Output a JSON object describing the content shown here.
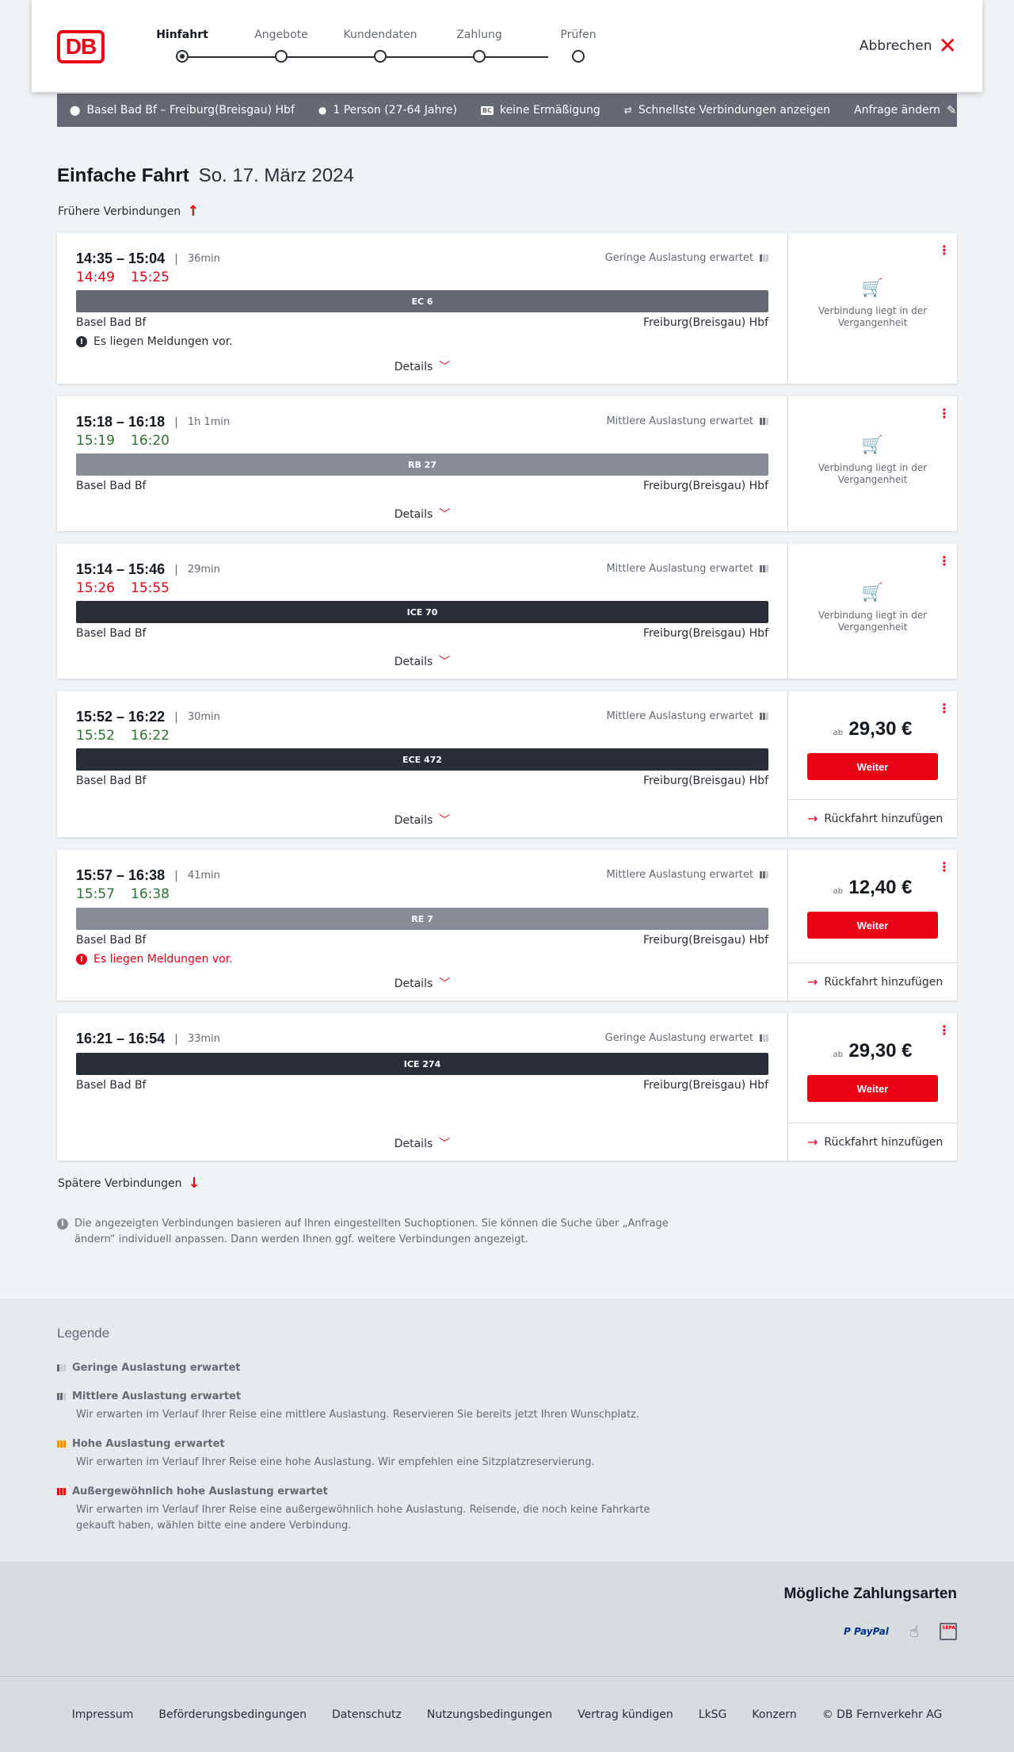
{
  "header": {
    "logo": "DB",
    "steps": [
      {
        "label": "Hinfahrt",
        "active": true
      },
      {
        "label": "Angebote",
        "active": false
      },
      {
        "label": "Kundendaten",
        "active": false
      },
      {
        "label": "Zahlung",
        "active": false
      },
      {
        "label": "Prüfen",
        "active": false
      }
    ],
    "cancel_label": "Abbrechen"
  },
  "search": {
    "route": "Basel Bad Bf – Freiburg(Breisgau) Hbf",
    "passengers": "1 Person (27-64 Jahre)",
    "discount_badge": "BC",
    "discount": "keine Ermäßigung",
    "fastest": "Schnellste Verbindungen anzeigen",
    "change": "Anfrage ändern"
  },
  "trip": {
    "type": "Einfache Fahrt",
    "date": "So. 17. März 2024",
    "earlier": "Frühere Verbindungen",
    "later": "Spätere Verbindungen"
  },
  "connections": [
    {
      "times": "14:35 – 15:04",
      "duration": "36min",
      "rt_dep": "14:49",
      "rt_arr": "15:25",
      "rt_status": "delayed",
      "load": "Geringe Auslastung erwartet",
      "load_level": 1,
      "train": "EC 6",
      "bar": "grey",
      "from": "Basel Bad Bf",
      "to": "Freiburg(Breisgau) Hbf",
      "message": "Es liegen Meldungen vor.",
      "message_type": "info",
      "details": "Details",
      "past_text": "Verbindung liegt in der Vergangenheit",
      "price_prefix": null,
      "price": null,
      "cta": null,
      "return_label": null
    },
    {
      "times": "15:18 – 16:18",
      "duration": "1h 1min",
      "rt_dep": "15:19",
      "rt_arr": "16:20",
      "rt_status": "ontime",
      "load": "Mittlere Auslastung erwartet",
      "load_level": 2,
      "train": "RB 27",
      "bar": "light",
      "from": "Basel Bad Bf",
      "to": "Freiburg(Breisgau) Hbf",
      "message": null,
      "message_type": null,
      "details": "Details",
      "past_text": "Verbindung liegt in der Vergangenheit",
      "price_prefix": null,
      "price": null,
      "cta": null,
      "return_label": null
    },
    {
      "times": "15:14 – 15:46",
      "duration": "29min",
      "rt_dep": "15:26",
      "rt_arr": "15:55",
      "rt_status": "delayed",
      "load": "Mittlere Auslastung erwartet",
      "load_level": 2,
      "train": "ICE 70",
      "bar": "dark",
      "from": "Basel Bad Bf",
      "to": "Freiburg(Breisgau) Hbf",
      "message": null,
      "message_type": null,
      "details": "Details",
      "past_text": "Verbindung liegt in der Vergangenheit",
      "price_prefix": null,
      "price": null,
      "cta": null,
      "return_label": null
    },
    {
      "times": "15:52 – 16:22",
      "duration": "30min",
      "rt_dep": "15:52",
      "rt_arr": "16:22",
      "rt_status": "ontime",
      "load": "Mittlere Auslastung erwartet",
      "load_level": 2,
      "train": "ECE 472",
      "bar": "dark",
      "from": "Basel Bad Bf",
      "to": "Freiburg(Breisgau) Hbf",
      "message": null,
      "message_type": null,
      "details": "Details",
      "past_text": null,
      "price_prefix": "ab",
      "price": "29,30 €",
      "cta": "Weiter",
      "return_label": "Rückfahrt hinzufügen"
    },
    {
      "times": "15:57 – 16:38",
      "duration": "41min",
      "rt_dep": "15:57",
      "rt_arr": "16:38",
      "rt_status": "ontime",
      "load": "Mittlere Auslastung erwartet",
      "load_level": 2,
      "train": "RE 7",
      "bar": "light",
      "from": "Basel Bad Bf",
      "to": "Freiburg(Breisgau) Hbf",
      "message": "Es liegen Meldungen vor.",
      "message_type": "warning",
      "details": "Details",
      "past_text": null,
      "price_prefix": "ab",
      "price": "12,40 €",
      "cta": "Weiter",
      "return_label": "Rückfahrt hinzufügen"
    },
    {
      "times": "16:21 – 16:54",
      "duration": "33min",
      "rt_dep": null,
      "rt_arr": null,
      "rt_status": null,
      "load": "Geringe Auslastung erwartet",
      "load_level": 1,
      "train": "ICE 274",
      "bar": "dark",
      "from": "Basel Bad Bf",
      "to": "Freiburg(Breisgau) Hbf",
      "message": null,
      "message_type": null,
      "details": "Details",
      "past_text": null,
      "price_prefix": "ab",
      "price": "29,30 €",
      "cta": "Weiter",
      "return_label": "Rückfahrt hinzufügen"
    }
  ],
  "note": "Die angezeigten Verbindungen basieren auf Ihren eingestellten Suchoptionen. Sie können die Suche über „Anfrage ändern“ individuell anpassen. Dann werden Ihnen ggf. weitere Verbindungen angezeigt.",
  "legend": {
    "title": "Legende",
    "items": [
      {
        "title": "Geringe Auslastung erwartet",
        "text": "",
        "level": 1,
        "color": "#646973"
      },
      {
        "title": "Mittlere Auslastung erwartet",
        "text": "Wir erwarten im Verlauf Ihrer Reise eine mittlere Auslastung. Reservieren Sie bereits jetzt Ihren Wunschplatz.",
        "level": 2,
        "color": "#646973"
      },
      {
        "title": "Hohe Auslastung erwartet",
        "text": "Wir erwarten im Verlauf Ihrer Reise eine hohe Auslastung. Wir empfehlen eine Sitzplatzreservierung.",
        "level": 3,
        "color": "#f39200"
      },
      {
        "title": "Außergewöhnlich hohe Auslastung erwartet",
        "text": "Wir erwarten im Verlauf Ihrer Reise eine außergewöhnlich hohe Auslastung. Reisende, die noch keine Fahrkarte gekauft haben, wählen bitte eine andere Verbindung.",
        "level": 4,
        "color": "#ec0016"
      }
    ]
  },
  "payment": {
    "title": "Mögliche Zahlungsarten",
    "paypal_a": "P PayPal",
    "sepa": "SEPA",
    "icons": [
      "paypal-icon",
      "card-touch-icon",
      "sepa-icon"
    ]
  },
  "footer": {
    "links": [
      "Impressum",
      "Beförderungsbedingungen",
      "Datenschutz",
      "Nutzungsbedingungen",
      "Vertrag kündigen",
      "LkSG",
      "Konzern",
      "© DB Fernverkehr AG"
    ]
  },
  "colors": {
    "brand": "#ec0016",
    "delay": "#ec0016",
    "ontime": "#2a7230",
    "bar_dark": "#282d37",
    "bar_grey": "#646973",
    "bar_light": "#878c96"
  }
}
